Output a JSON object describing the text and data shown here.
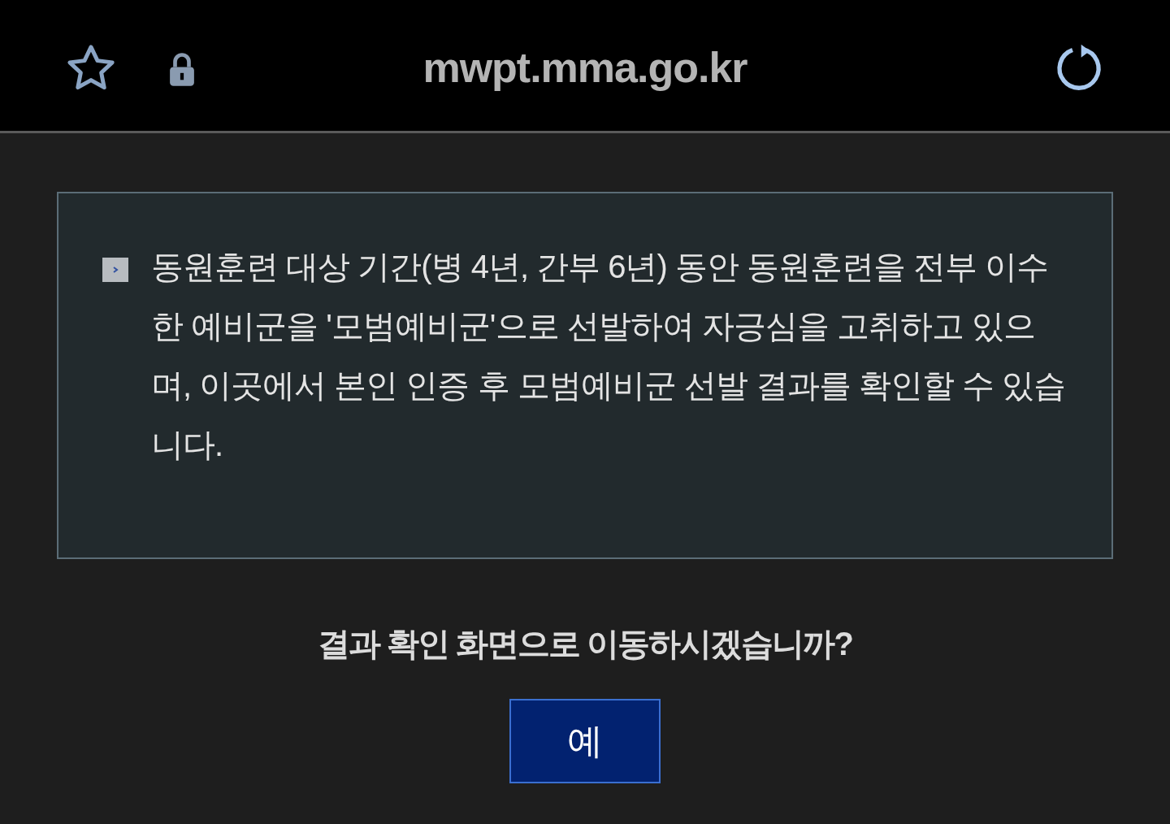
{
  "address_bar": {
    "url": "mwpt.mma.go.kr"
  },
  "notice": {
    "text": "동원훈련 대상 기간(병 4년, 간부 6년) 동안 동원훈련을 전부 이수한 예비군을 '모범예비군'으로 선발하여 자긍심을 고취하고 있으며, 이곳에서 본인 인증 후 모범예비군 선발 결과를 확인할 수 있습니다."
  },
  "question": "결과 확인 화면으로 이동하시겠습니까?",
  "buttons": [
    "예"
  ]
}
